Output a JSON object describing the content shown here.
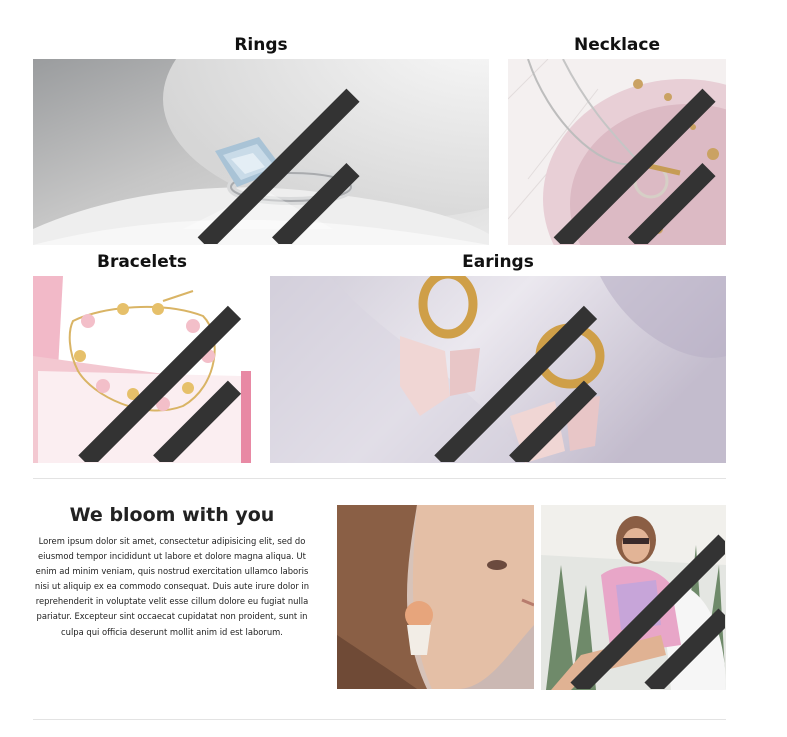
{
  "categories": [
    {
      "key": "rings",
      "title": "Rings",
      "image": "diamond-ring-photo"
    },
    {
      "key": "necklace",
      "title": "Necklace",
      "image": "gold-necklace-photo"
    },
    {
      "key": "bracelets",
      "title": "Bracelets",
      "image": "flower-bracelet-photo"
    },
    {
      "key": "earings",
      "title": "Earings",
      "image": "butterfly-earrings-photo"
    }
  ],
  "bloom": {
    "title": "We bloom with you",
    "body": "Lorem ipsum dolor sit amet, consectetur adipisicing elit, sed do eiusmod tempor incididunt ut labore et dolore magna aliqua. Ut enim ad minim veniam, quis nostrud exercitation ullamco laboris nisi ut aliquip ex ea commodo consequat. Duis aute irure dolor in reprehenderit in voluptate velit esse cillum dolore eu fugiat nulla pariatur. Excepteur sint occaecat cupidatat non proident, sunt in culpa qui officia deserunt mollit anim id est laborum."
  },
  "gallery": [
    {
      "image": "model-earring-closeup-photo"
    },
    {
      "image": "model-sunglasses-photo"
    }
  ],
  "colors": {
    "text": "#111111",
    "divider": "#e3e3e3"
  },
  "icons": [
    "resize-handle-icon"
  ]
}
